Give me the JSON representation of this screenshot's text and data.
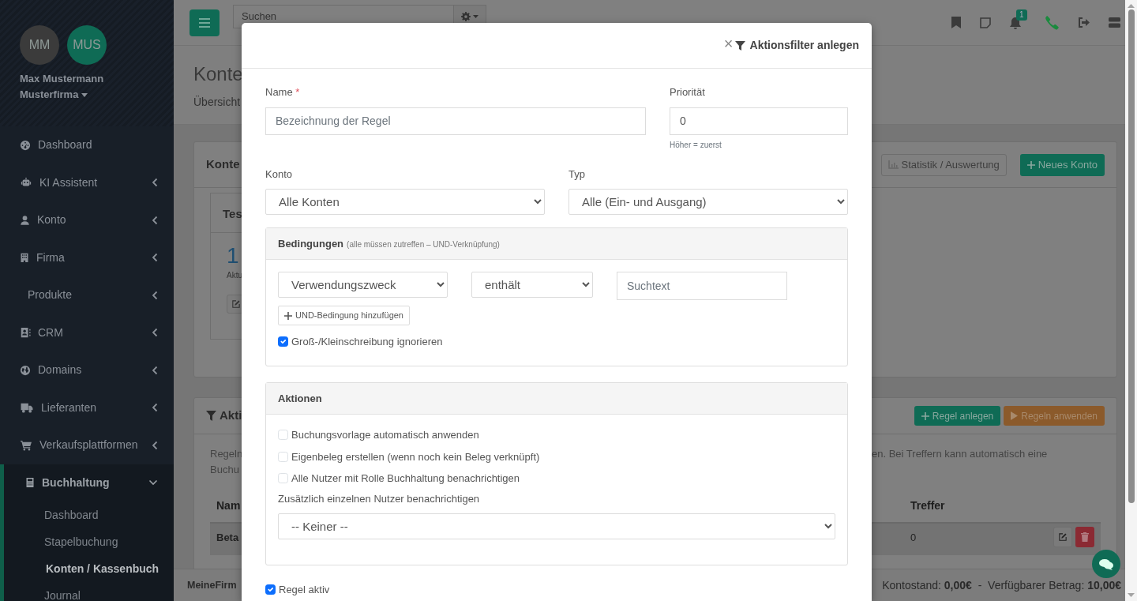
{
  "sidebar": {
    "avatars": [
      {
        "initials": "MM",
        "color": "#3b3b3b"
      },
      {
        "initials": "MUS",
        "color": "#0f6b55"
      }
    ],
    "user_name": "Max Mustermann",
    "company": "Musterfirma",
    "menu": [
      {
        "label": "Dashboard",
        "kind": "link"
      },
      {
        "label": "KI Assistent",
        "kind": "group",
        "expanded": false
      },
      {
        "label": "Konto",
        "kind": "group",
        "expanded": false
      },
      {
        "label": "Firma",
        "kind": "group",
        "expanded": false
      },
      {
        "label": "Produkte",
        "kind": "group",
        "expanded": false
      },
      {
        "label": "CRM",
        "kind": "group",
        "expanded": false
      },
      {
        "label": "Domains",
        "kind": "group",
        "expanded": false
      },
      {
        "label": "Lieferanten",
        "kind": "group",
        "expanded": false
      },
      {
        "label": "Verkaufsplattformen",
        "kind": "group",
        "expanded": false
      },
      {
        "label": "Buchhaltung",
        "kind": "group",
        "expanded": true,
        "children": [
          {
            "label": "Dashboard",
            "selected": false
          },
          {
            "label": "Stapelbuchung",
            "selected": false
          },
          {
            "label": "Konten / Kassenbuch",
            "selected": true
          },
          {
            "label": "Journal",
            "selected": false
          }
        ]
      }
    ]
  },
  "topbar": {
    "search_placeholder": "Suchen",
    "notification_count": "1"
  },
  "page": {
    "title": "Konte",
    "subtitle": "Übersicht",
    "accounts_card": {
      "header": "Konte",
      "buttons": [
        {
          "label": "Statistik / Auswertung",
          "kind": "outline"
        },
        {
          "label": "Neues Konto",
          "kind": "primary"
        }
      ],
      "tile": {
        "title": "Tes",
        "value": "1",
        "caption": "Aktu"
      }
    },
    "filters_card": {
      "header": "Akti",
      "buttons": [
        {
          "label": "Regel anlegen",
          "kind": "primary"
        },
        {
          "label": "Regeln anwenden",
          "kind": "warning"
        }
      ],
      "text_left": [
        "Regeln",
        "Buchu"
      ],
      "text_right": "en. Bei Treffern kann automatisch eine",
      "columns": [
        "Nam",
        "Treffer"
      ],
      "rows": [
        {
          "cells": [
            "Beta",
            "0"
          ]
        }
      ]
    }
  },
  "footer": {
    "left": "MeineFirm",
    "right": "Kontostand: **0,00€**  -  Verfügbarer Betrag: **10,00€**"
  },
  "modal": {
    "close_label": "×",
    "title": "Aktionsfilter anlegen",
    "name": {
      "label": "Name",
      "required_mark": "*",
      "placeholder": "Bezeichnung der Regel"
    },
    "priority": {
      "label": "Priorität",
      "value": "0",
      "help": "Höher = zuerst"
    },
    "account": {
      "label": "Konto",
      "value": "Alle Konten"
    },
    "type": {
      "label": "Typ",
      "value": "Alle (Ein- und Ausgang)"
    },
    "conditions": {
      "title": "Bedingungen",
      "note": "(alle müssen zutreffen – UND-Verknüpfung)",
      "field": "Verwendungszweck",
      "operator": "enthält",
      "search_placeholder": "Suchtext",
      "add_button": "UND-Bedingung hinzufügen",
      "ignore_case": {
        "label": "Groß-/Kleinschreibung ignorieren",
        "checked": true
      }
    },
    "actions": {
      "title": "Aktionen",
      "options": [
        {
          "label": "Buchungsvorlage automatisch anwenden",
          "checked": false
        },
        {
          "label": "Eigenbeleg erstellen (wenn noch kein Beleg verknüpft)",
          "checked": false
        },
        {
          "label": "Alle Nutzer mit Rolle Buchhaltung benachrichtigen",
          "checked": false
        }
      ],
      "notify_label": "Zusätzlich einzelnen Nutzer benachrichtigen",
      "notify_value": "-- Keiner --"
    },
    "active": {
      "label": "Regel aktiv",
      "checked": true
    }
  }
}
